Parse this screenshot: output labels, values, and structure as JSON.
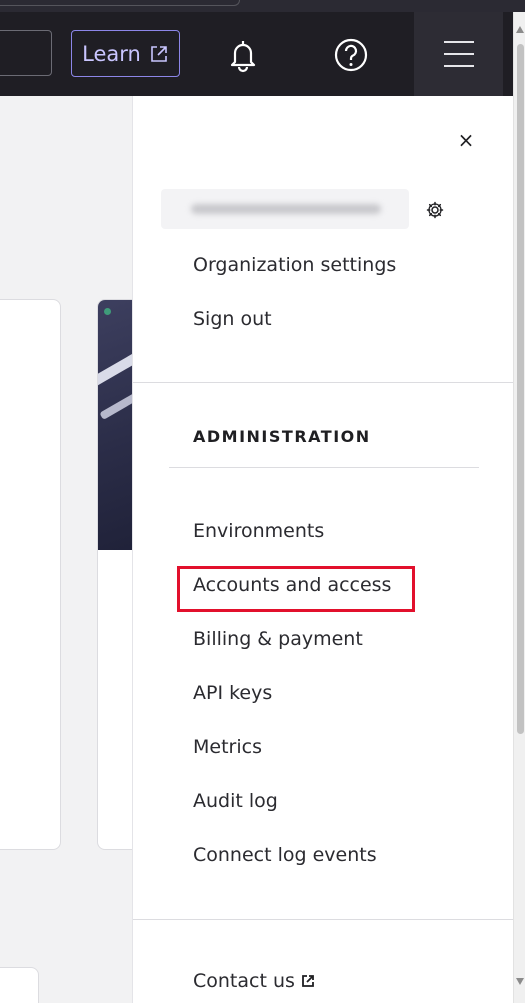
{
  "header": {
    "learn_label": "Learn",
    "icons": [
      "external-link-icon",
      "bell-icon",
      "help-icon",
      "hamburger-menu-icon"
    ]
  },
  "menu": {
    "close_glyph": "×",
    "account_links": [
      {
        "label": "Organization settings"
      },
      {
        "label": "Sign out"
      }
    ],
    "admin_section_title": "ADMINISTRATION",
    "admin_links": [
      {
        "label": "Environments"
      },
      {
        "label": "Accounts and access"
      },
      {
        "label": "Billing & payment"
      },
      {
        "label": "API keys"
      },
      {
        "label": "Metrics"
      },
      {
        "label": "Audit log"
      },
      {
        "label": "Connect log events"
      }
    ],
    "footer_links": [
      {
        "label": "Contact us"
      }
    ]
  },
  "colors": {
    "header_bg": "#1f1e24",
    "learn_accent": "#8c86e8",
    "highlight": "#e2102c"
  }
}
